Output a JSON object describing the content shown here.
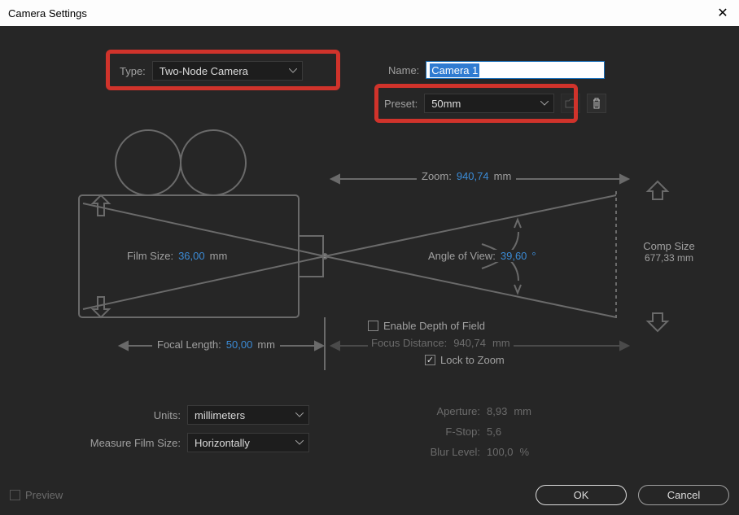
{
  "titlebar": {
    "title": "Camera Settings"
  },
  "fields": {
    "type": {
      "label": "Type:",
      "value": "Two-Node Camera"
    },
    "name": {
      "label": "Name:",
      "value": "Camera 1"
    },
    "preset": {
      "label": "Preset:",
      "value": "50mm"
    },
    "units": {
      "label": "Units:",
      "value": "millimeters"
    },
    "measure": {
      "label": "Measure Film Size:",
      "value": "Horizontally"
    }
  },
  "diagram": {
    "zoom": {
      "label": "Zoom:",
      "value": "940,74",
      "unit": "mm"
    },
    "film_size": {
      "label": "Film Size:",
      "value": "36,00",
      "unit": "mm"
    },
    "angle": {
      "label": "Angle of View:",
      "value": "39,60",
      "unit": "°"
    },
    "comp_size": {
      "label": "Comp Size",
      "value": "677,33",
      "unit": "mm"
    },
    "focal_length": {
      "label": "Focal Length:",
      "value": "50,00",
      "unit": "mm"
    }
  },
  "depth": {
    "enable": {
      "label": "Enable Depth of Field",
      "checked": false
    },
    "focus": {
      "label": "Focus Distance:",
      "value": "940,74",
      "unit": "mm"
    },
    "lock": {
      "label": "Lock to Zoom",
      "checked": true
    },
    "aperture": {
      "label": "Aperture:",
      "value": "8,93",
      "unit": "mm"
    },
    "fstop": {
      "label": "F-Stop:",
      "value": "5,6"
    },
    "blur": {
      "label": "Blur Level:",
      "value": "100,0",
      "unit": "%"
    }
  },
  "footer": {
    "preview": "Preview",
    "ok": "OK",
    "cancel": "Cancel"
  }
}
